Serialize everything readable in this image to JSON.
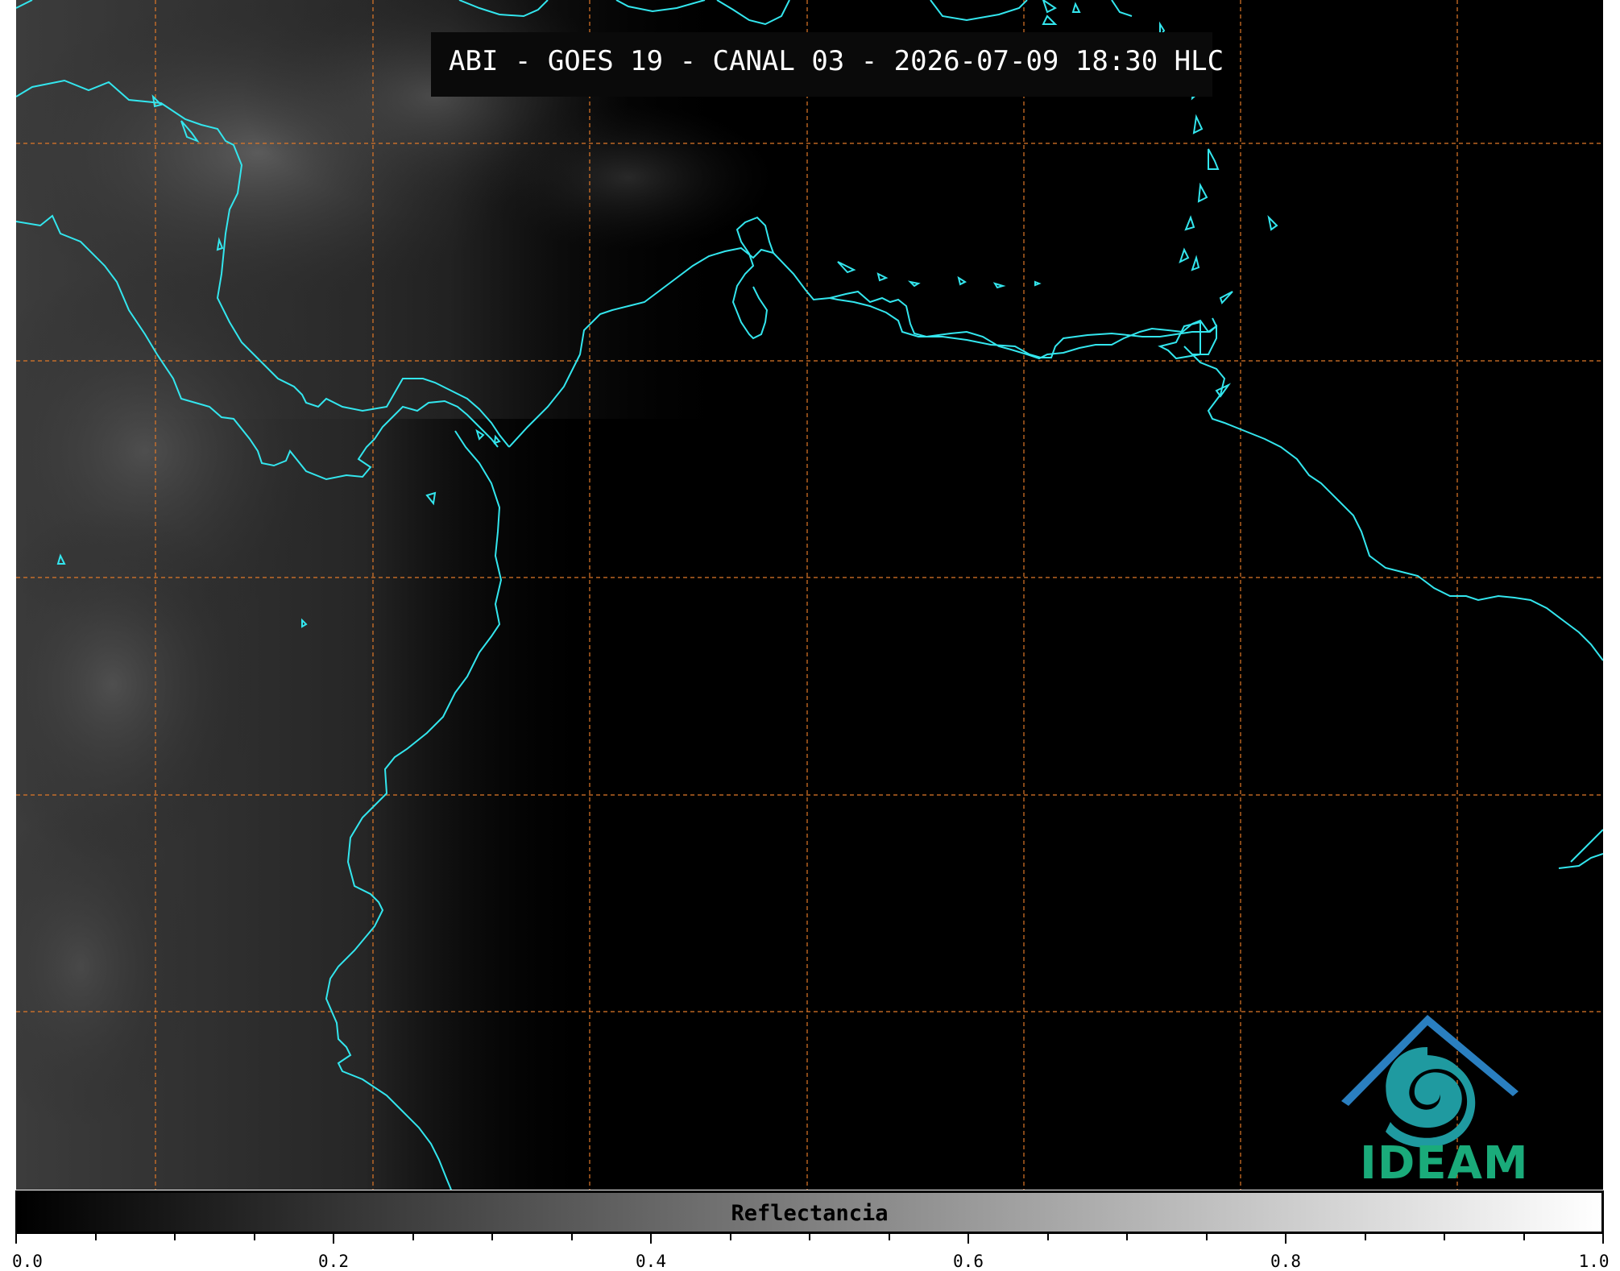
{
  "title": "ABI - GOES 19 - CANAL 03 - 2026-07-09 18:30 HLC",
  "colorbar": {
    "label": "Reflectancia",
    "range": [
      0.0,
      1.0
    ],
    "major_ticks": [
      "0.0",
      "0.2",
      "0.4",
      "0.6",
      "0.8",
      "1.0"
    ],
    "colormap": [
      "#000000",
      "#ffffff"
    ]
  },
  "logo": {
    "text": "IDEAM"
  },
  "colors": {
    "coastline": "#33e6ee",
    "gridlines": "#e07828",
    "logo_blue": "#2a7fc0",
    "logo_green": "#1aab7a"
  },
  "map": {
    "gridlines": "dashed",
    "imagery": "visible reflectance, dim cloud field in west, dark elsewhere"
  }
}
